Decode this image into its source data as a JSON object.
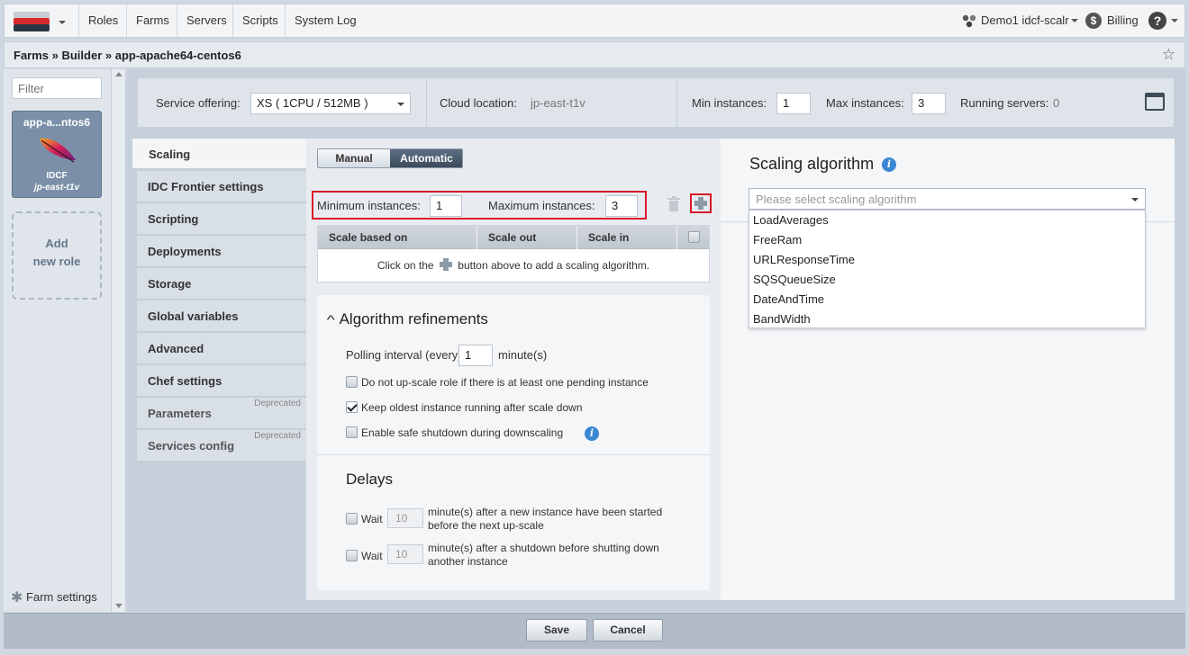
{
  "nav": {
    "items": [
      "Roles",
      "Farms",
      "Servers",
      "Scripts",
      "System Log"
    ],
    "user": "Demo1 idcf-scalr",
    "billing": "Billing"
  },
  "breadcrumb": "Farms » Builder » app-apache64-centos6",
  "left": {
    "filter_placeholder": "Filter",
    "role": {
      "name": "app-a...ntos6",
      "cloud": "IDCF",
      "location": "jp-east-t1v"
    },
    "add_role": [
      "Add",
      "new role"
    ],
    "farm_settings": "Farm settings"
  },
  "settings": {
    "service_offering_label": "Service offering:",
    "service_offering_value": "XS ( 1CPU / 512MB )",
    "cloud_location_label": "Cloud location:",
    "cloud_location_value": "jp-east-t1v",
    "min_label": "Min instances:",
    "min_value": "1",
    "max_label": "Max instances:",
    "max_value": "3",
    "running_label": "Running servers:",
    "running_value": "0"
  },
  "tabs": [
    {
      "label": "Scaling"
    },
    {
      "label": "IDC Frontier settings"
    },
    {
      "label": "Scripting"
    },
    {
      "label": "Deployments"
    },
    {
      "label": "Storage"
    },
    {
      "label": "Global variables"
    },
    {
      "label": "Advanced"
    },
    {
      "label": "Chef settings"
    },
    {
      "label": "Parameters",
      "badge": "Deprecated"
    },
    {
      "label": "Services config",
      "badge": "Deprecated"
    }
  ],
  "scaling": {
    "mode_manual": "Manual",
    "mode_automatic": "Automatic",
    "min_label": "Minimum instances:",
    "min_value": "1",
    "max_label": "Maximum instances:",
    "max_value": "3",
    "grid_headers": [
      "Scale based on",
      "Scale out",
      "Scale in"
    ],
    "grid_empty_before": "Click on the",
    "grid_empty_after": "button above to add a scaling algorithm.",
    "refinements_title": "Algorithm refinements",
    "polling_label": "Polling interval (every)",
    "polling_value": "1",
    "polling_unit": "minute(s)",
    "opt_no_upscale": "Do not up-scale role if there is at least one pending instance",
    "opt_keep_oldest": "Keep oldest instance running after scale down",
    "opt_safe_shutdown": "Enable safe shutdown during downscaling",
    "delays_title": "Delays",
    "wait_label": "Wait",
    "delay1_value": "10",
    "delay1_text_1": "minute(s) after a new instance have been started",
    "delay1_text_2": "before the next up-scale",
    "delay2_value": "10",
    "delay2_text_1": "minute(s) after a shutdown before shutting down",
    "delay2_text_2": "another instance"
  },
  "algorithm": {
    "title": "Scaling algorithm",
    "placeholder": "Please select scaling algorithm",
    "options": [
      "LoadAverages",
      "FreeRam",
      "URLResponseTime",
      "SQSQueueSize",
      "DateAndTime",
      "BandWidth"
    ]
  },
  "footer": {
    "save": "Save",
    "cancel": "Cancel"
  }
}
